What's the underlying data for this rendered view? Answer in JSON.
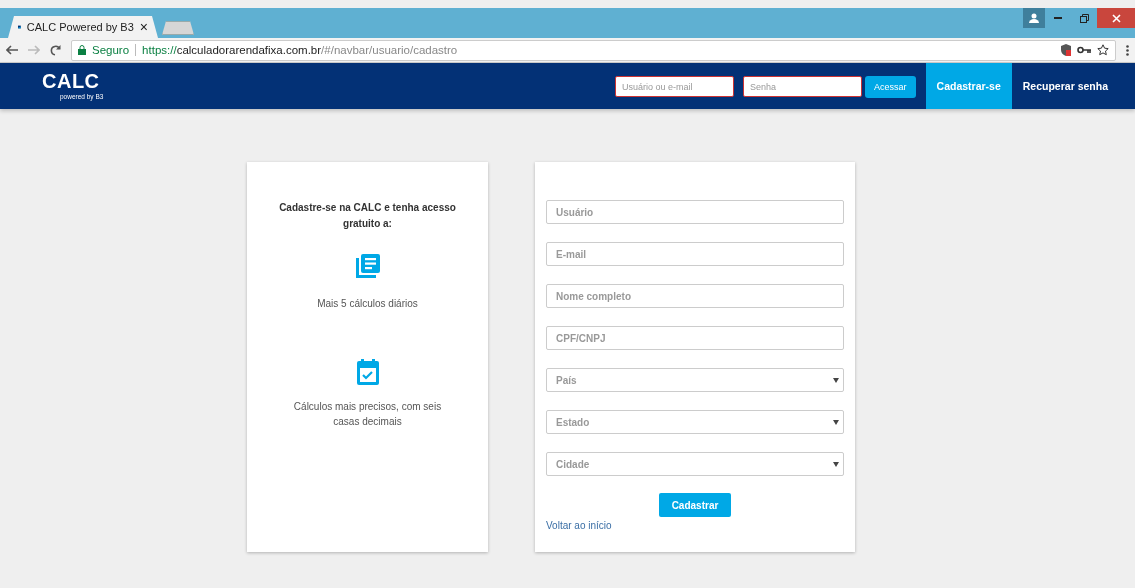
{
  "browser": {
    "tab_title": "CALC Powered by B3",
    "close_tab": "×",
    "security_label": "Seguro",
    "url_scheme": "https://",
    "url_host": "calculadorarendafixa.com.br",
    "url_path": "/#/navbar/usuario/cadastro"
  },
  "navbar": {
    "logo": "CALC",
    "logo_sub": "powered by B3",
    "login": {
      "user_placeholder": "Usuário ou e-mail",
      "password_placeholder": "Senha",
      "submit": "Acessar"
    },
    "links": [
      {
        "label": "Cadastrar-se",
        "selected": true
      },
      {
        "label": "Recuperar senha",
        "selected": false
      }
    ]
  },
  "benefits": {
    "heading": "Cadastre-se na CALC e tenha acesso gratuito a:",
    "items": [
      {
        "kind": "documents",
        "text": "Mais 5 cálculos diários"
      },
      {
        "kind": "calendar",
        "text": "Cálculos mais precisos, com seis casas decimais"
      }
    ]
  },
  "form": {
    "fields": [
      {
        "kind": "text",
        "placeholder": "Usuário"
      },
      {
        "kind": "text",
        "placeholder": "E-mail"
      },
      {
        "kind": "text",
        "placeholder": "Nome completo"
      },
      {
        "kind": "text",
        "placeholder": "CPF/CNPJ"
      },
      {
        "kind": "select",
        "placeholder": "País"
      },
      {
        "kind": "select",
        "placeholder": "Estado"
      },
      {
        "kind": "select",
        "placeholder": "Cidade"
      }
    ],
    "submit": "Cadastrar",
    "back_link": "Voltar ao início"
  }
}
